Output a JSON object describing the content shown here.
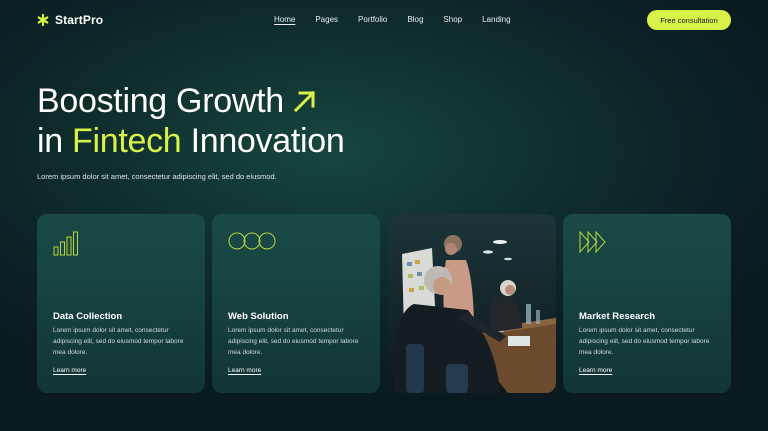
{
  "brand": {
    "name": "StartPro",
    "icon": "asterisk-logo-icon"
  },
  "nav": {
    "items": [
      {
        "label": "Home",
        "active": true
      },
      {
        "label": "Pages",
        "active": false
      },
      {
        "label": "Portfolio",
        "active": false
      },
      {
        "label": "Blog",
        "active": false
      },
      {
        "label": "Shop",
        "active": false
      },
      {
        "label": "Landing",
        "active": false
      }
    ],
    "cta_label": "Free consultation"
  },
  "hero": {
    "title_line1": "Boosting Growth",
    "title_line2_accent": "Fintech",
    "title_line2_prefix": "in ",
    "title_line2_suffix": " Innovation",
    "arrow_icon": "arrow-up-right-icon",
    "subtitle": "Lorem ipsum dolor sit amet, consectetur adipiscing elit, sed do eiusmod."
  },
  "cards": [
    {
      "icon": "bar-chart-icon",
      "title": "Data Collection",
      "description": "Lorem ipsum dolor sit amet, consectetur adipiscing elit, sed do eiusmod tempor labore mea dolore.",
      "link": "Learn more"
    },
    {
      "icon": "three-circles-icon",
      "title": "Web Solution",
      "description": "Lorem ipsum dolor sit amet, consectetur adipiscing elit, sed do eiusmod tempor labore mea dolore.",
      "link": "Learn more"
    },
    {
      "icon": "triple-chevron-icon",
      "title": "Market Research",
      "description": "Lorem ipsum dolor sit amet, consectetur adipiscing elit, sed do eiusmod tempor labore mea dolore.",
      "link": "Learn more"
    }
  ],
  "colors": {
    "accent": "#d8f24a",
    "background": "#0b1f24",
    "card": "#16403f"
  }
}
